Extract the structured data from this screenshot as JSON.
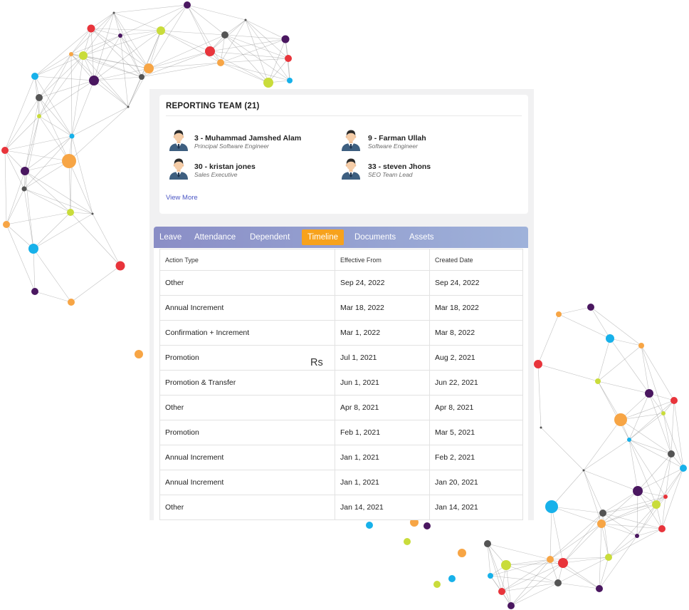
{
  "reporting_team": {
    "title": "REPORTING TEAM (21)",
    "members": [
      {
        "name": "3 - Muhammad Jamshed Alam",
        "role": "Principal Software Engineer",
        "avatar_icon": "user-avatar-icon"
      },
      {
        "name": "9 - Farman Ullah",
        "role": "Software Engineer",
        "avatar_icon": "user-avatar-icon"
      },
      {
        "name": "30 - kristan jones",
        "role": "Sales Executive",
        "avatar_icon": "user-avatar-icon"
      },
      {
        "name": "33 - steven Jhons",
        "role": "SEO Team Lead",
        "avatar_icon": "user-avatar-icon"
      }
    ],
    "view_more": "View More"
  },
  "tabs": [
    {
      "label": "Leave",
      "active": false
    },
    {
      "label": "Attendance",
      "active": false
    },
    {
      "label": "Dependent",
      "active": false
    },
    {
      "label": "Timeline",
      "active": true
    },
    {
      "label": "Documents",
      "active": false
    },
    {
      "label": "Assets",
      "active": false
    }
  ],
  "timeline": {
    "columns": [
      "Action Type",
      "Effective From",
      "Created Date"
    ],
    "rows": [
      {
        "action_type": "Other",
        "effective_from": "Sep 24, 2022",
        "created_date": "Sep 24, 2022"
      },
      {
        "action_type": "Annual Increment",
        "effective_from": "Mar 18, 2022",
        "created_date": "Mar 18, 2022"
      },
      {
        "action_type": "Confirmation + Increment",
        "effective_from": "Mar 1, 2022",
        "created_date": "Mar 8, 2022"
      },
      {
        "action_type": "Promotion",
        "effective_from": "Jul 1, 2021",
        "created_date": "Aug 2, 2021"
      },
      {
        "action_type": "Promotion & Transfer",
        "effective_from": "Jun 1, 2021",
        "created_date": "Jun 22, 2021"
      },
      {
        "action_type": "Other",
        "effective_from": "Apr 8, 2021",
        "created_date": "Apr 8, 2021"
      },
      {
        "action_type": "Promotion",
        "effective_from": "Feb 1, 2021",
        "created_date": "Mar 5, 2021"
      },
      {
        "action_type": "Annual Increment",
        "effective_from": "Jan 1, 2021",
        "created_date": "Feb 2, 2021"
      },
      {
        "action_type": "Annual Increment",
        "effective_from": "Jan 1, 2021",
        "created_date": "Jan 20, 2021"
      },
      {
        "action_type": "Other",
        "effective_from": "Jan 14, 2021",
        "created_date": "Jan 14, 2021"
      }
    ]
  },
  "overlay_text": "Rs",
  "colors": {
    "tab_bar_start": "#8a8ec6",
    "tab_bar_end": "#9fb2da",
    "active_tab": "#f7a21c",
    "link": "#4b56c4",
    "network": {
      "purple": "#4a1760",
      "red": "#e8343b",
      "lime": "#c9dc3b",
      "orange": "#f7a545",
      "blue": "#17b1ea",
      "grey": "#545454",
      "link_line": "#8e8e8e"
    }
  }
}
